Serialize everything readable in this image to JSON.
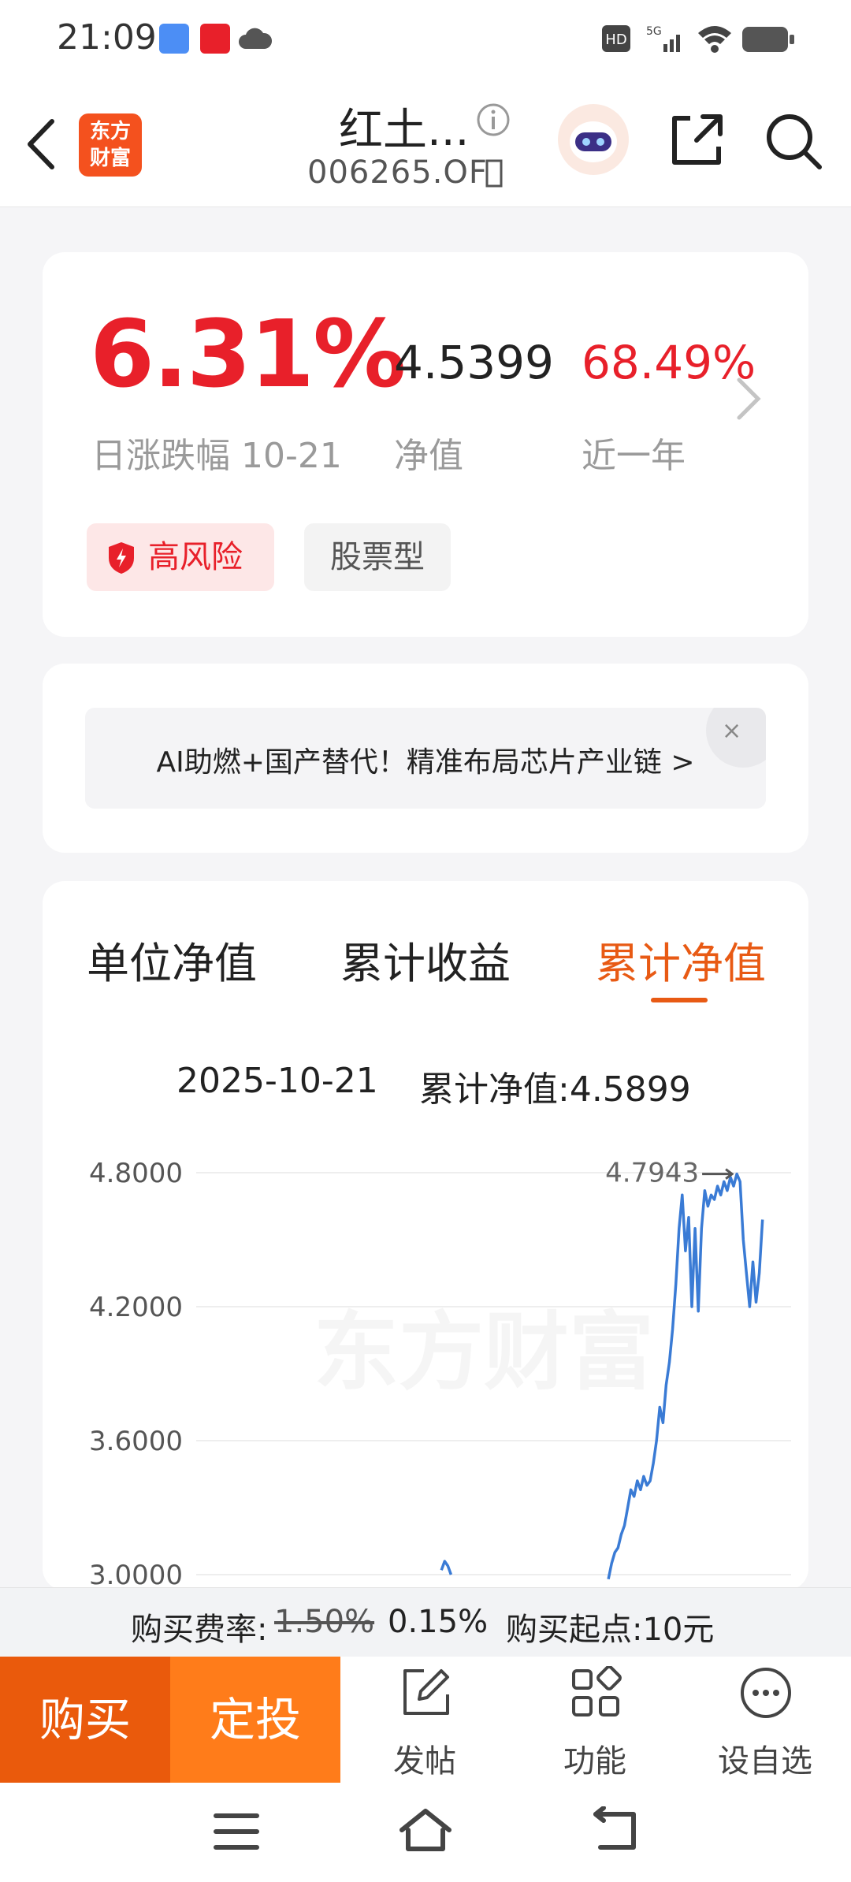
{
  "status_bar": {
    "time": "21:09"
  },
  "header": {
    "title": "红土...",
    "code": "006265.OF"
  },
  "summary": {
    "change_pct": "6.31%",
    "change_label": "日涨跌幅 10-21",
    "nav": "4.5399",
    "nav_label": "净值",
    "year_return": "68.49%",
    "year_label": "近一年",
    "tags": {
      "risk": "高风险",
      "type": "股票型"
    }
  },
  "ad": {
    "text": "AI助燃+国产替代！精准布局芯片产业链 >",
    "close": "×"
  },
  "chart_tabs": {
    "tabs": [
      "单位净值",
      "累计收益",
      "累计净值"
    ],
    "active": 2
  },
  "chart_info": {
    "date": "2025-10-21",
    "value": "累计净值:4.5899"
  },
  "watermark": "东方财富",
  "chart_data": {
    "type": "line",
    "yticks": [
      "4.8000",
      "4.2000",
      "3.6000",
      "3.0000"
    ],
    "ylim": [
      2.95,
      4.85
    ],
    "max_label": "4.7943",
    "series": [
      {
        "color": "#3a7bd5",
        "points": [
          [
            0.48,
            3.02
          ],
          [
            0.485,
            3.06
          ],
          [
            0.49,
            3.04
          ],
          [
            0.495,
            3.0
          ],
          [
            0.74,
            2.98
          ],
          [
            0.745,
            3.05
          ],
          [
            0.75,
            3.1
          ],
          [
            0.755,
            3.12
          ],
          [
            0.76,
            3.18
          ],
          [
            0.765,
            3.22
          ],
          [
            0.77,
            3.3
          ],
          [
            0.775,
            3.38
          ],
          [
            0.78,
            3.35
          ],
          [
            0.785,
            3.42
          ],
          [
            0.79,
            3.38
          ],
          [
            0.795,
            3.44
          ],
          [
            0.8,
            3.4
          ],
          [
            0.805,
            3.42
          ],
          [
            0.81,
            3.5
          ],
          [
            0.815,
            3.6
          ],
          [
            0.82,
            3.75
          ],
          [
            0.825,
            3.68
          ],
          [
            0.83,
            3.85
          ],
          [
            0.835,
            3.95
          ],
          [
            0.84,
            4.1
          ],
          [
            0.845,
            4.3
          ],
          [
            0.85,
            4.55
          ],
          [
            0.855,
            4.7
          ],
          [
            0.86,
            4.45
          ],
          [
            0.865,
            4.6
          ],
          [
            0.87,
            4.2
          ],
          [
            0.875,
            4.55
          ],
          [
            0.88,
            4.18
          ],
          [
            0.885,
            4.55
          ],
          [
            0.89,
            4.72
          ],
          [
            0.895,
            4.65
          ],
          [
            0.9,
            4.7
          ],
          [
            0.905,
            4.68
          ],
          [
            0.91,
            4.74
          ],
          [
            0.915,
            4.7
          ],
          [
            0.92,
            4.76
          ],
          [
            0.925,
            4.72
          ],
          [
            0.93,
            4.78
          ],
          [
            0.935,
            4.74
          ],
          [
            0.94,
            4.7943
          ],
          [
            0.945,
            4.76
          ],
          [
            0.95,
            4.5
          ],
          [
            0.955,
            4.35
          ],
          [
            0.96,
            4.2
          ],
          [
            0.965,
            4.4
          ],
          [
            0.97,
            4.22
          ],
          [
            0.975,
            4.35
          ],
          [
            0.98,
            4.59
          ]
        ]
      }
    ]
  },
  "footer": {
    "fee_label": "购买费率:",
    "fee_old": "1.50%",
    "fee_new": "0.15%",
    "min_buy": "购买起点:10元",
    "buy": "购买",
    "plan": "定投",
    "actions": [
      "发帖",
      "功能",
      "设自选"
    ]
  }
}
